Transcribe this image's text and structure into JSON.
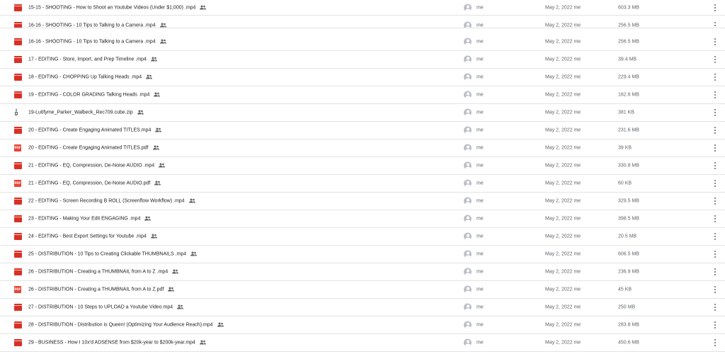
{
  "owner_label": "me",
  "files": [
    {
      "name": "15-15 - SHOOTING - How to Shoot an Youtube Videos (Under $1,000) .mp4",
      "type": "video",
      "modified": "May 2, 2022 me",
      "size": "603.3 MB"
    },
    {
      "name": "16-16 - SHOOTING - 10 Tips to Talking to a Camera .mp4",
      "type": "video",
      "modified": "May 2, 2022 me",
      "size": "256.5 MB"
    },
    {
      "name": "16-16 - SHOOTING - 10 Tips to Talking to a Camera .mp4",
      "type": "video",
      "modified": "May 2, 2022 me",
      "size": "256.5 MB"
    },
    {
      "name": "17 - EDITING - Store, Import, and Prep Timeline .mp4",
      "type": "video",
      "modified": "May 2, 2022 me",
      "size": "39.4 MB"
    },
    {
      "name": "18 - EDITING - CHOPPING Up Talking Heads .mp4",
      "type": "video",
      "modified": "May 2, 2022 me",
      "size": "229.4 MB"
    },
    {
      "name": "19 - EDITING - COLOR GRADING Talking Heads .mp4",
      "type": "video",
      "modified": "May 2, 2022 me",
      "size": "162.6 MB"
    },
    {
      "name": "19-Lutifyme_Parker_Walbeck_Rec709.cube.zip",
      "type": "zip",
      "modified": "May 2, 2022 me",
      "size": "381 KB"
    },
    {
      "name": "20 - EDITING - Create Engaging Animated TITLES.mp4",
      "type": "video",
      "modified": "May 2, 2022 me",
      "size": "231.6 MB"
    },
    {
      "name": "20 - EDITING - Create Engaging Animated TITLES.pdf",
      "type": "pdf",
      "modified": "May 2, 2022 me",
      "size": "39 KB"
    },
    {
      "name": "21 - EDITING - EQ, Compression, De-Noise AUDIO .mp4",
      "type": "video",
      "modified": "May 2, 2022 me",
      "size": "330.8 MB"
    },
    {
      "name": "21 - EDITING - EQ, Compression, De-Noise AUDIO.pdf",
      "type": "pdf",
      "modified": "May 2, 2022 me",
      "size": "60 KB"
    },
    {
      "name": "22 - EDITING - Screen Recording B ROLL (Screenflow Workflow) .mp4",
      "type": "video",
      "modified": "May 2, 2022 me",
      "size": "329.5 MB"
    },
    {
      "name": "23 - EDITING - Making Your Edit ENGAGING .mp4",
      "type": "video",
      "modified": "May 2, 2022 me",
      "size": "398.5 MB"
    },
    {
      "name": "24 - EDITING - Best Export Settings for Youtube .mp4",
      "type": "video",
      "modified": "May 2, 2022 me",
      "size": "20.5 MB"
    },
    {
      "name": "25 - DISTRIBUTION - 10 Tips to Creating Clickable THUMBNAILS .mp4",
      "type": "video",
      "modified": "May 2, 2022 me",
      "size": "606.5 MB"
    },
    {
      "name": "26 - DISTRIBUTION - Creating a THUMBNAIL from A to Z .mp4",
      "type": "video",
      "modified": "May 2, 2022 me",
      "size": "236.9 MB"
    },
    {
      "name": "26 - DISTRIBUTION - Creating a THUMBNAIL from A to Z.pdf",
      "type": "pdf",
      "modified": "May 2, 2022 me",
      "size": "45 KB"
    },
    {
      "name": "27 - DISTRIBUTION - 10 Steps to UPLOAD a Youtube Video.mp4",
      "type": "video",
      "modified": "May 2, 2022 me",
      "size": "250 MB"
    },
    {
      "name": "28 - DISTRIBUTION - Distribution is Queen! (Optimizing Your Audience Reach).mp4",
      "type": "video",
      "modified": "May 2, 2022 me",
      "size": "283.8 MB"
    },
    {
      "name": "29 - BUSINESS - How I 10x'd ADSENSE from $20k-year to $200k-year.mp4",
      "type": "video",
      "modified": "May 2, 2022 me",
      "size": "450.6 MB"
    }
  ],
  "icons": {
    "video": "video-file-icon",
    "pdf": "pdf-file-icon",
    "zip": "zip-file-icon",
    "shared": "shared-people-icon",
    "avatar": "user-avatar-icon",
    "more": "more-vert-icon"
  },
  "colors": {
    "video": "#d93025",
    "pdf": "#ea4335",
    "divider": "#e3e3e3",
    "secondary_text": "#5f6368"
  }
}
